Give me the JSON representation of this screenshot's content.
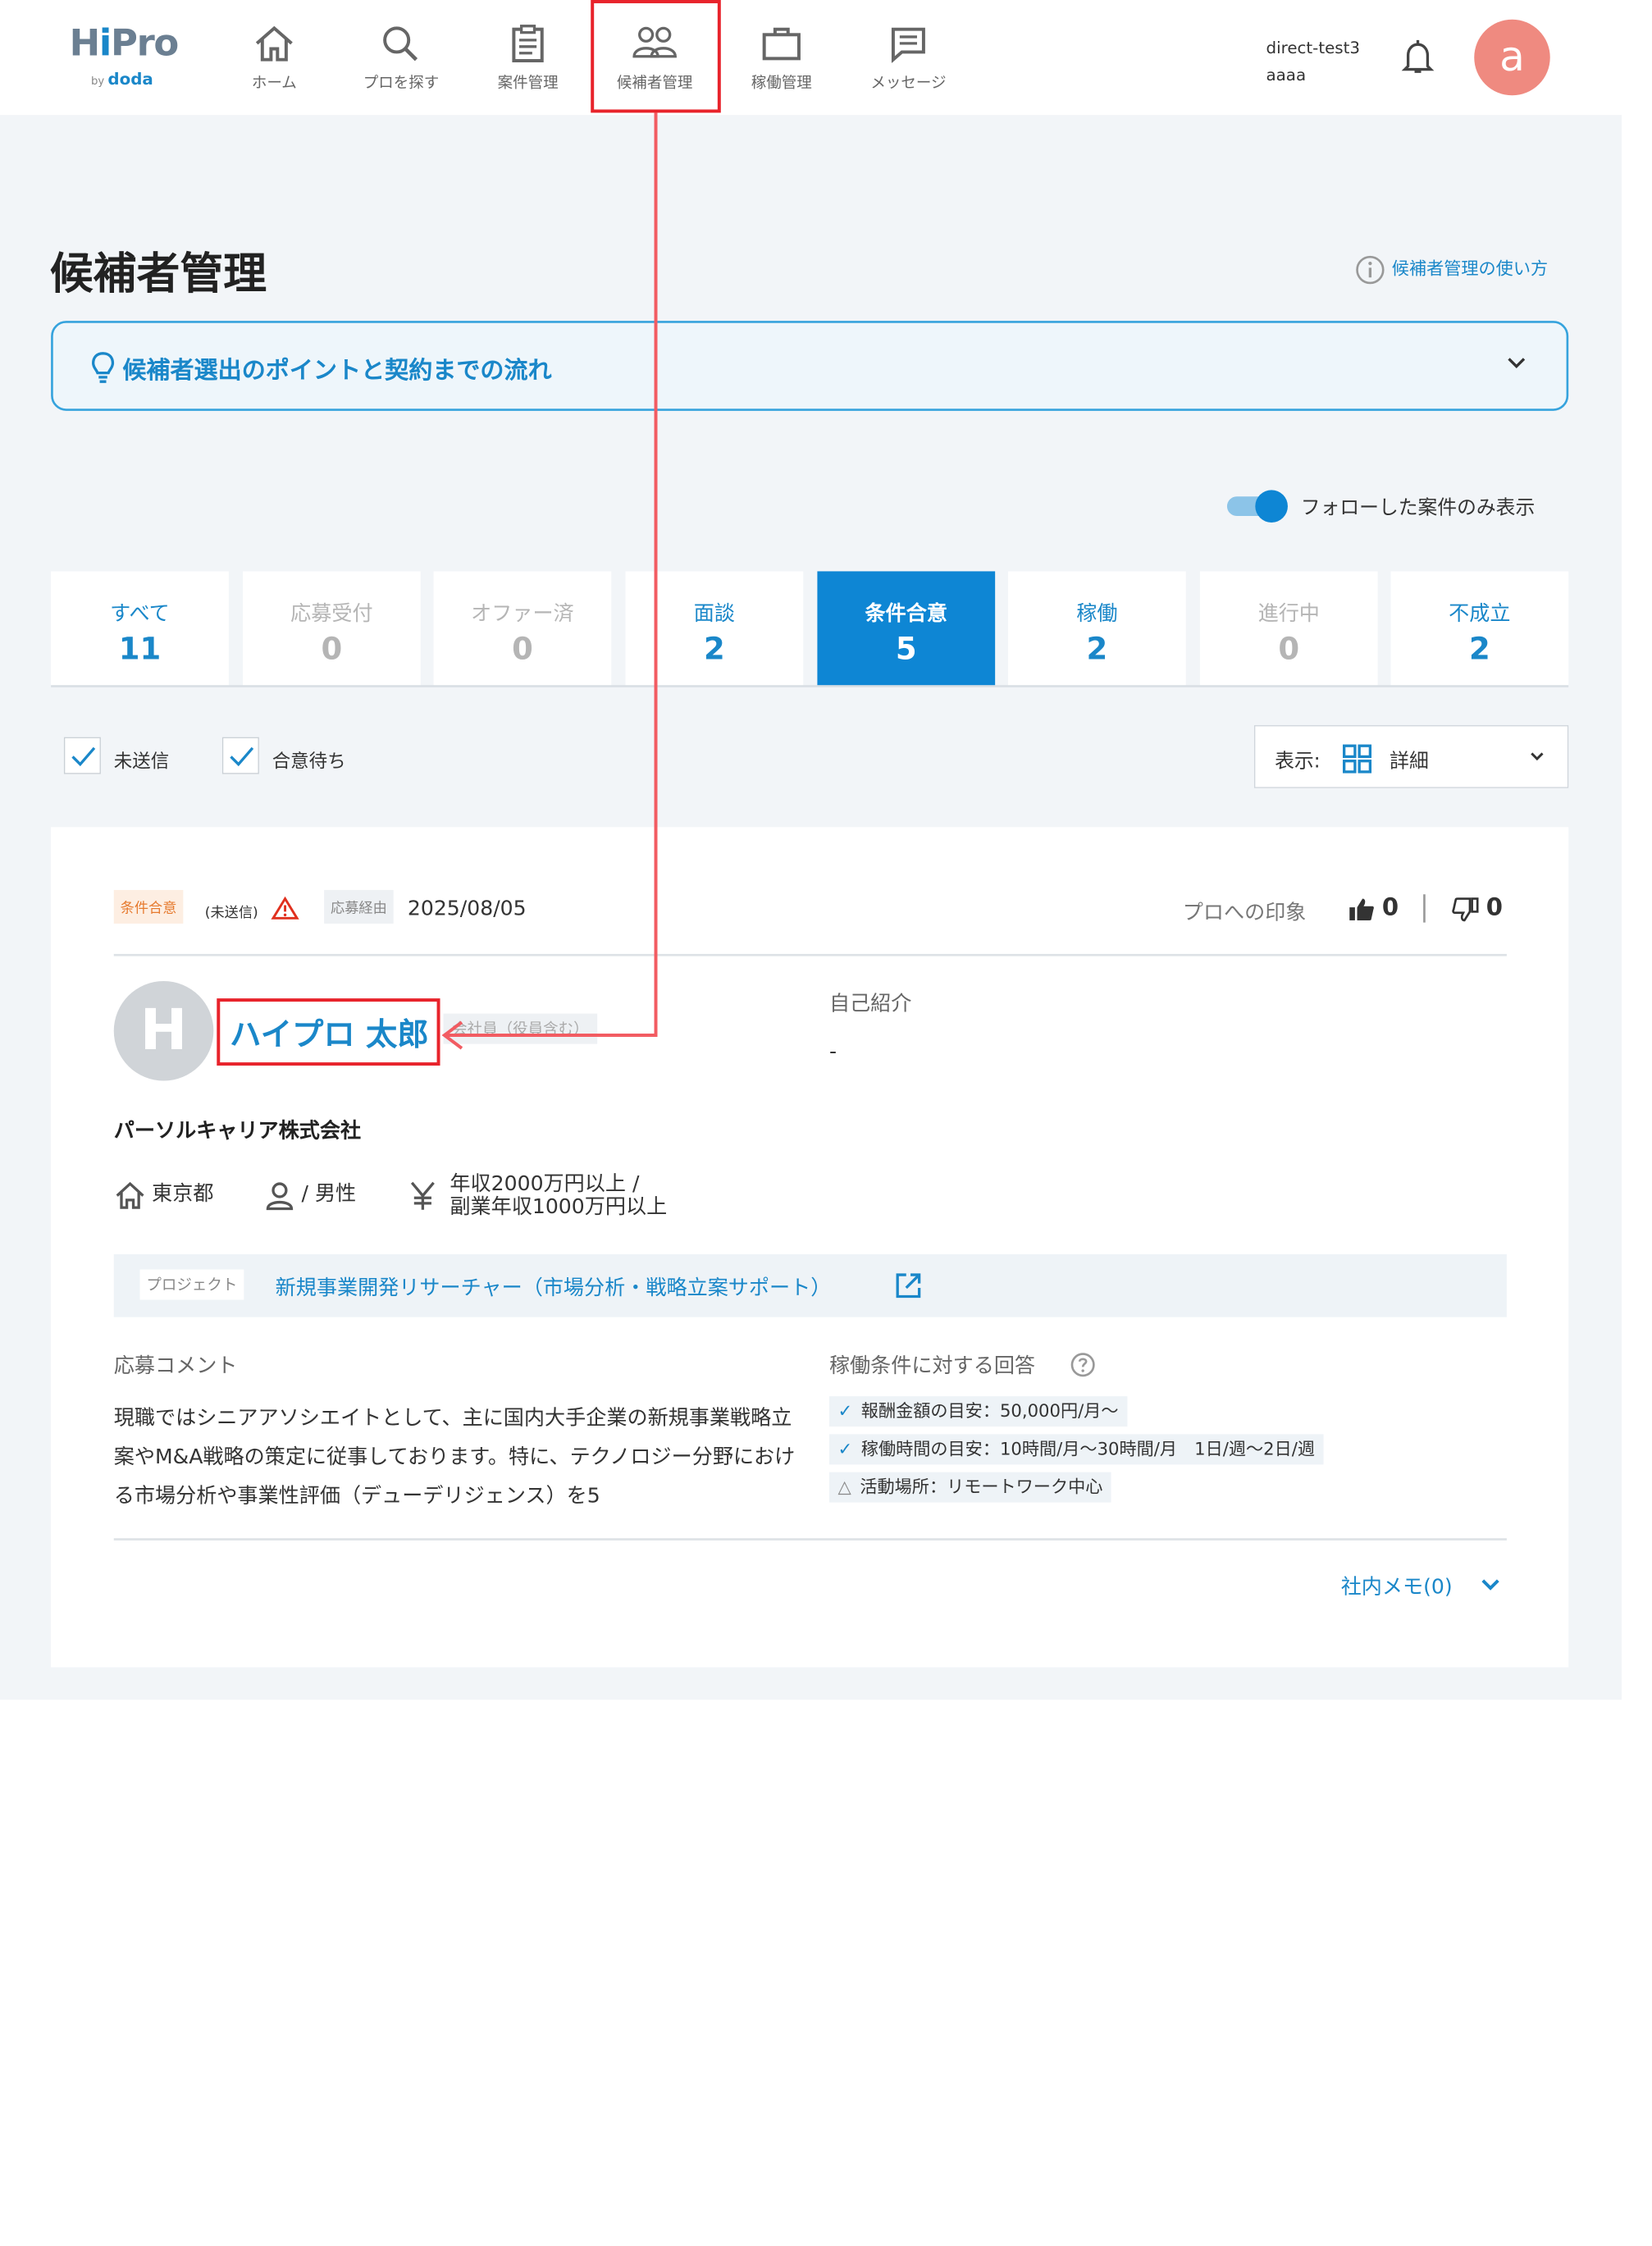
{
  "header": {
    "logo_main_pre": "H",
    "logo_main_i": "i",
    "logo_main_post": "Pro",
    "logo_by": "by ",
    "logo_doda": "doda",
    "nav": [
      {
        "label": "ホーム",
        "icon": "home-icon"
      },
      {
        "label": "プロを探す",
        "icon": "search-icon"
      },
      {
        "label": "案件管理",
        "icon": "clipboard-icon"
      },
      {
        "label": "候補者管理",
        "icon": "people-icon"
      },
      {
        "label": "稼働管理",
        "icon": "briefcase-icon"
      },
      {
        "label": "メッセージ",
        "icon": "message-icon"
      }
    ],
    "user_line1": "direct-test3",
    "user_line2": "aaaa",
    "avatar_letter": "a",
    "avatar_color": "#ef8a80"
  },
  "page": {
    "title": "候補者管理",
    "help_link": "候補者管理の使い方",
    "tips_text": "候補者選出のポイントと契約までの流れ",
    "toggle_label": "フォローした案件のみ表示",
    "toggle_on": true
  },
  "tabs": [
    {
      "label": "すべて",
      "count": "11",
      "state": "blue"
    },
    {
      "label": "応募受付",
      "count": "0",
      "state": "gray"
    },
    {
      "label": "オファー済",
      "count": "0",
      "state": "gray"
    },
    {
      "label": "面談",
      "count": "2",
      "state": "blue"
    },
    {
      "label": "条件合意",
      "count": "5",
      "state": "active"
    },
    {
      "label": "稼働",
      "count": "2",
      "state": "blue"
    },
    {
      "label": "進行中",
      "count": "0",
      "state": "gray"
    },
    {
      "label": "不成立",
      "count": "2",
      "state": "blue"
    }
  ],
  "filters": {
    "check1": {
      "label": "未送信",
      "checked": true
    },
    "check2": {
      "label": "合意待ち",
      "checked": true
    },
    "view_label": "表示:",
    "view_value": "詳細"
  },
  "card": {
    "status_badge": "条件合意",
    "unsent": "(未送信)",
    "route_badge": "応募経由",
    "route_date": "2025/08/05",
    "impression_label": "プロへの印象",
    "up_count": "0",
    "down_count": "0",
    "avatar_letter": "H",
    "name": "ハイプロ 太郎",
    "employment_type": "会社員（役員含む）",
    "intro_label": "自己紹介",
    "intro_value": "-",
    "company": "パーソルキャリア株式会社",
    "location": "東京都",
    "gender": "/ 男性",
    "salary_line1": "年収2000万円以上 /",
    "salary_line2": "副業年収1000万円以上",
    "project_tag": "プロジェクト",
    "project_link": "新規事業開発リサーチャー（市場分析・戦略立案サポート）",
    "comment_label": "応募コメント",
    "comment_body": "現職ではシニアアソシエイトとして、主に国内大手企業の新規事業戦略立案やM&A戦略の策定に従事しております。特に、テクノロジー分野における市場分析や事業性評価（デューデリジェンス）を5",
    "answer_label": "稼働条件に対する回答",
    "answers": [
      {
        "mark": "✓",
        "text": "報酬金額の目安：50,000円/月〜"
      },
      {
        "mark": "✓",
        "text": "稼働時間の目安：10時間/月〜30時間/月　1日/週〜2日/週"
      },
      {
        "mark": "△",
        "text": "活動場所：リモートワーク中心"
      }
    ],
    "memo": "社内メモ(0)"
  },
  "colors": {
    "accent": "#1a87c9",
    "active_tab": "#0e86d4",
    "annotation_red": "#e8232b",
    "page_bg": "#f2f5f8"
  }
}
